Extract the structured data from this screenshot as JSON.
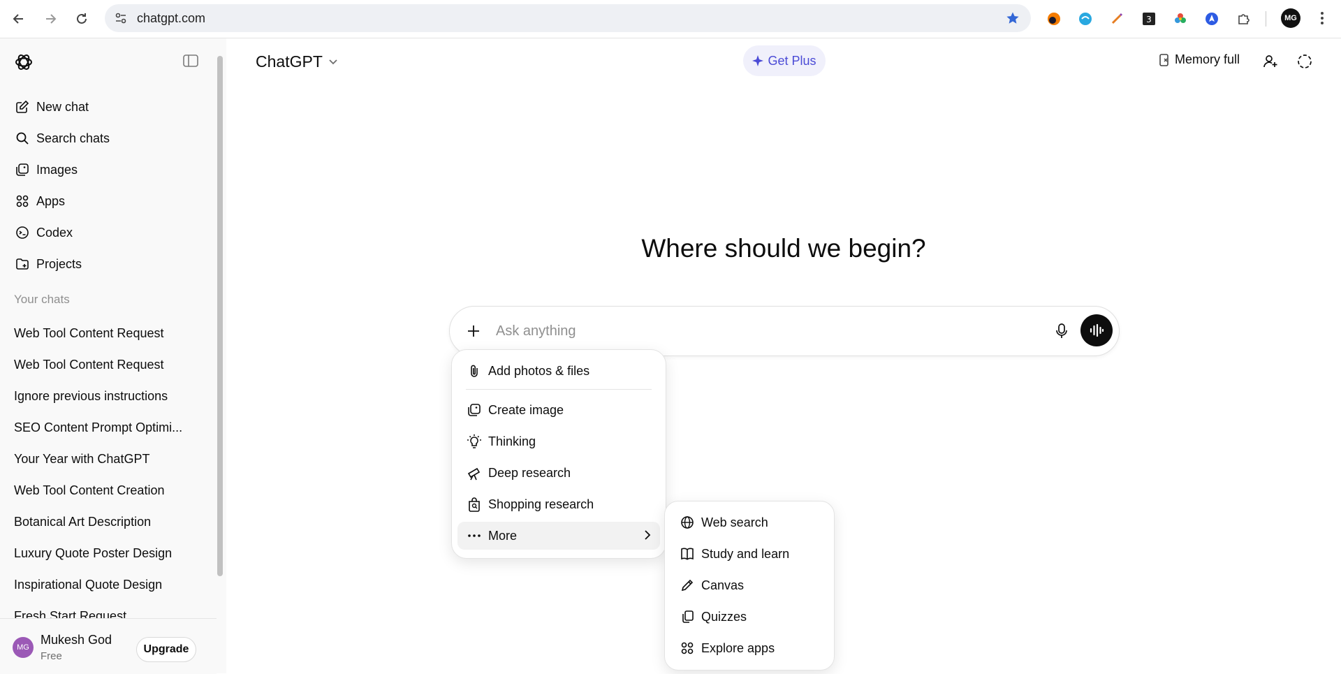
{
  "browser": {
    "url": "chatgpt.com",
    "profile_initials": "MG"
  },
  "sidebar": {
    "nav": [
      {
        "label": "New chat",
        "icon": "edit-icon"
      },
      {
        "label": "Search chats",
        "icon": "search-icon"
      },
      {
        "label": "Images",
        "icon": "images-icon"
      },
      {
        "label": "Apps",
        "icon": "apps-icon"
      },
      {
        "label": "Codex",
        "icon": "codex-icon"
      },
      {
        "label": "Projects",
        "icon": "folder-icon"
      }
    ],
    "section_title": "Your chats",
    "chats": [
      "Web Tool Content Request",
      "Web Tool Content Request",
      "Ignore previous instructions",
      "SEO Content Prompt Optimi...",
      "Your Year with ChatGPT",
      "Web Tool Content Creation",
      "Botanical Art Description",
      "Luxury Quote Poster Design",
      "Inspirational Quote Design",
      "Fresh Start Request"
    ],
    "user": {
      "initials": "MG",
      "name": "Mukesh God",
      "plan": "Free",
      "upgrade_label": "Upgrade"
    }
  },
  "header": {
    "model": "ChatGPT",
    "get_plus": "Get Plus",
    "memory": "Memory full"
  },
  "main": {
    "headline": "Where should we begin?",
    "placeholder": "Ask anything"
  },
  "plus_menu": {
    "items": [
      {
        "label": "Add photos & files",
        "icon": "paperclip-icon"
      },
      {
        "label": "Create image",
        "icon": "image-create-icon"
      },
      {
        "label": "Thinking",
        "icon": "lightbulb-icon"
      },
      {
        "label": "Deep research",
        "icon": "telescope-icon"
      },
      {
        "label": "Shopping research",
        "icon": "shopping-bag-icon"
      },
      {
        "label": "More",
        "icon": "more-dots-icon"
      }
    ]
  },
  "more_menu": {
    "items": [
      {
        "label": "Web search",
        "icon": "globe-icon"
      },
      {
        "label": "Study and learn",
        "icon": "book-icon"
      },
      {
        "label": "Canvas",
        "icon": "pencil-icon"
      },
      {
        "label": "Quizzes",
        "icon": "quiz-icon"
      },
      {
        "label": "Explore apps",
        "icon": "apps-icon"
      }
    ]
  },
  "colors": {
    "accent": "#4b4bd6",
    "sidebar_bg": "#f9f9f9",
    "avatar": "#9b59b6"
  }
}
